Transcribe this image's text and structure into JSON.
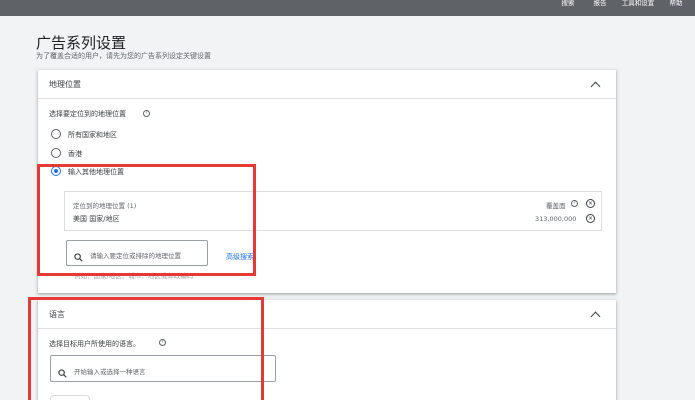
{
  "topbar": {
    "items": [
      "搜索",
      "报告",
      "工具和设置",
      "帮助"
    ]
  },
  "page": {
    "title": "广告系列设置",
    "subtitle": "为了覆盖合适的用户，请先为您的广告系列设定关键设置"
  },
  "location": {
    "title": "地理位置",
    "prompt": "选择要定位到的地理位置",
    "options": [
      "所有国家和地区",
      "香港",
      "输入其他地理位置"
    ],
    "selected_index": 2,
    "targeted_header": "定位到的地理位置 (1)",
    "reach_header": "覆盖面",
    "targeted_location": "美国 国家/地区",
    "targeted_reach": "313,000,000",
    "search_placeholder": "请输入要定位或排除的地理位置",
    "advanced_search": "高级搜索",
    "example_hint": "例如：国家/地区、城市、地区或邮政编码"
  },
  "language": {
    "title": "语言",
    "prompt": "选择目标用户所使用的语言。",
    "search_placeholder": "开始输入或选择一种语言"
  },
  "colors": {
    "accent": "#1a73e8",
    "highlight": "#e53935",
    "topbar": "#5f6368"
  }
}
